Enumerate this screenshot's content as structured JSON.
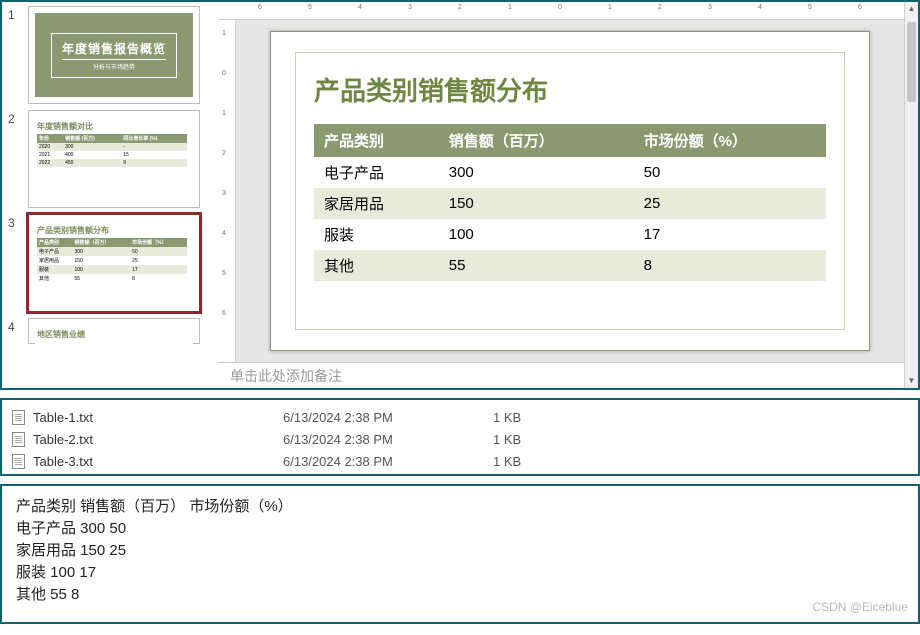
{
  "ruler": {
    "labels": [
      "6",
      "5",
      "4",
      "3",
      "2",
      "1",
      "0",
      "1",
      "2",
      "3",
      "4",
      "5",
      "6"
    ]
  },
  "rulerV": {
    "labels": [
      "1",
      "0",
      "1",
      "2",
      "3",
      "4",
      "5",
      "6"
    ]
  },
  "thumbnails": {
    "selected_index": 3,
    "slide1": {
      "title": "年度销售报告概览",
      "subtitle": "分析与市场趋势"
    },
    "slide2": {
      "title": "年度销售额对比",
      "headers": [
        "年份",
        "销售额 (百万)",
        "同比增长率 (%)"
      ],
      "rows": [
        [
          "2020",
          "300",
          "-"
        ],
        [
          "2021",
          "400",
          "15"
        ],
        [
          "2022",
          "450",
          "9"
        ]
      ]
    },
    "slide4": {
      "title": "地区销售业绩"
    }
  },
  "slide": {
    "title": "产品类别销售额分布",
    "headers": [
      "产品类别",
      "销售额（百万）",
      "市场份额（%）"
    ],
    "rows": [
      {
        "c1": "电子产品",
        "c2": "300",
        "c3": "50"
      },
      {
        "c1": "家居用品",
        "c2": "150",
        "c3": "25"
      },
      {
        "c1": "服装",
        "c2": "100",
        "c3": "17"
      },
      {
        "c1": "其他",
        "c2": "55",
        "c3": "8"
      }
    ]
  },
  "notes": {
    "placeholder": "单击此处添加备注"
  },
  "files": [
    {
      "name": "Table-1.txt",
      "modified": "6/13/2024 2:38 PM",
      "size": "1 KB"
    },
    {
      "name": "Table-2.txt",
      "modified": "6/13/2024 2:38 PM",
      "size": "1 KB"
    },
    {
      "name": "Table-3.txt",
      "modified": "6/13/2024 2:38 PM",
      "size": "1 KB"
    }
  ],
  "output": {
    "header": "产品类别    销售额（百万）    市场份额（%）",
    "rows": [
      "电子产品    300    50",
      "家居用品    150    25",
      "服装  100    17",
      "其他  55     8"
    ]
  },
  "watermark": "CSDN @Eiceblue",
  "chart_data": {
    "type": "table",
    "title": "产品类别销售额分布",
    "columns": [
      "产品类别",
      "销售额（百万）",
      "市场份额（%）"
    ],
    "rows": [
      [
        "电子产品",
        300,
        50
      ],
      [
        "家居用品",
        150,
        25
      ],
      [
        "服装",
        100,
        17
      ],
      [
        "其他",
        55,
        8
      ]
    ]
  }
}
